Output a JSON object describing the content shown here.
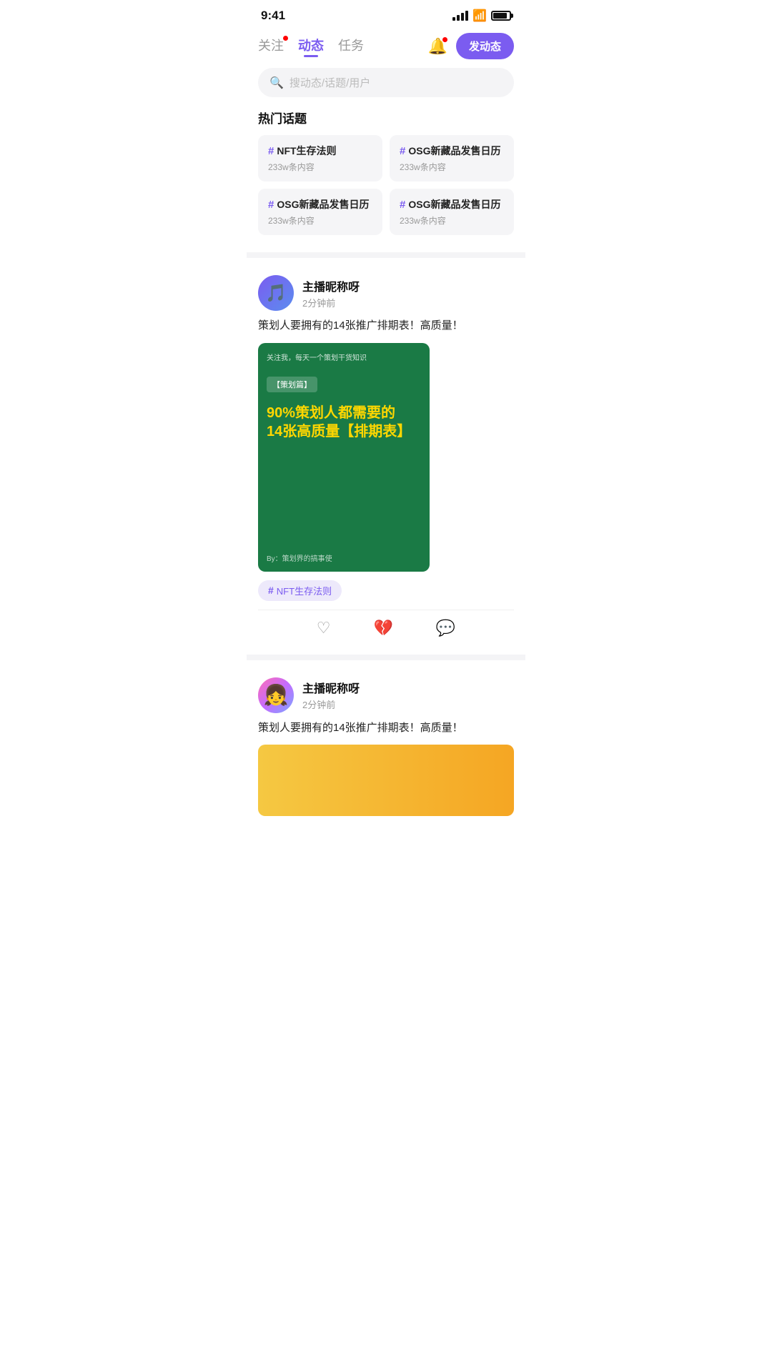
{
  "statusBar": {
    "time": "9:41",
    "battery": 85
  },
  "nav": {
    "tabs": [
      {
        "id": "follow",
        "label": "关注",
        "hasRedDot": true,
        "active": false
      },
      {
        "id": "feed",
        "label": "动态",
        "hasRedDot": false,
        "active": true
      },
      {
        "id": "tasks",
        "label": "任务",
        "hasRedDot": false,
        "active": false
      }
    ],
    "postButtonLabel": "发动态",
    "bellHasRedDot": true
  },
  "search": {
    "placeholder": "搜动态/话题/用户"
  },
  "hotTopics": {
    "sectionTitle": "热门话题",
    "topics": [
      {
        "id": 1,
        "hash": "#",
        "title": "NFT生存法则",
        "count": "233w条内容"
      },
      {
        "id": 2,
        "hash": "#",
        "title": "OSG新藏品发售日历",
        "count": "233w条内容"
      },
      {
        "id": 3,
        "hash": "#",
        "title": "OSG新藏品发售日历",
        "count": "233w条内容"
      },
      {
        "id": 4,
        "hash": "#",
        "title": "OSG新藏品发售日历",
        "count": "233w条内容"
      }
    ]
  },
  "posts": [
    {
      "id": 1,
      "username": "主播昵称呀",
      "time": "2分钟前",
      "content": "策划人要拥有的14张推广排期表！高质量！",
      "imageTopText": "关注我，每天一个策划干货知识",
      "imageLabel": "【策划篇】",
      "imageMainText": "90%策划人都需要的\n14张高质量【排期表】",
      "imageBottomText": "By：策划界的搞事使",
      "tagHash": "#",
      "tagLabel": "NFT生存法则",
      "actions": {
        "like": "♡",
        "dislike": "💔",
        "comment": "💬"
      }
    },
    {
      "id": 2,
      "username": "主播昵称呀",
      "time": "2分钟前",
      "content": "策划人要拥有的14张推广排期表！高质量！"
    }
  ]
}
